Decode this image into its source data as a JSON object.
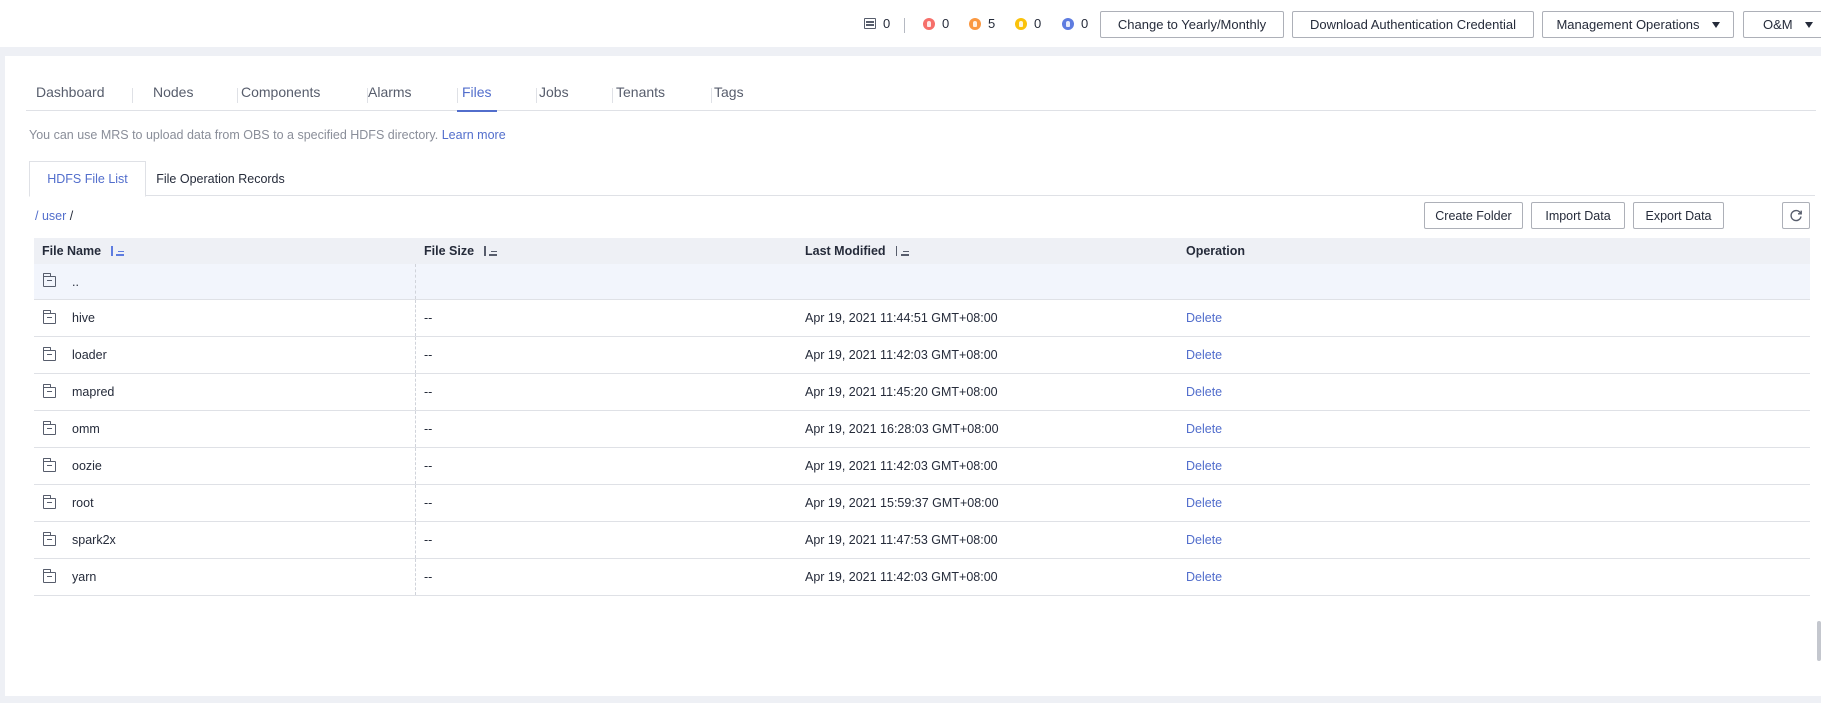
{
  "header": {
    "counters": [
      {
        "icon": "server-icon",
        "value": "0",
        "color": "#575d6c"
      },
      {
        "icon": "critical-alarm-icon",
        "value": "0",
        "color": "#f66f6a"
      },
      {
        "icon": "major-alarm-icon",
        "value": "5",
        "color": "#fa9841"
      },
      {
        "icon": "minor-alarm-icon",
        "value": "0",
        "color": "#fac20a"
      },
      {
        "icon": "warning-alarm-icon",
        "value": "0",
        "color": "#5e7ce0"
      }
    ],
    "buttons": {
      "change_billing": "Change to Yearly/Monthly",
      "download_credential": "Download Authentication Credential",
      "management_operations": "Management Operations",
      "om": "O&M"
    }
  },
  "tabs": [
    "Dashboard",
    "Nodes",
    "Components",
    "Alarms",
    "Files",
    "Jobs",
    "Tenants",
    "Tags"
  ],
  "active_tab": "Files",
  "tip": {
    "text": "You can use MRS to upload data from OBS to a specified HDFS directory.",
    "link": "Learn more"
  },
  "subtabs": [
    "HDFS File List",
    "File Operation Records"
  ],
  "breadcrumb": {
    "root": "/",
    "dir": "user",
    "trail": "/"
  },
  "actions": {
    "create_folder": "Create Folder",
    "import_data": "Import Data",
    "export_data": "Export Data"
  },
  "table": {
    "columns": [
      "File Name",
      "File Size",
      "Last Modified",
      "Operation"
    ],
    "parent_row": "..",
    "rows": [
      {
        "name": "hive",
        "size": "--",
        "modified": "Apr 19, 2021 11:44:51 GMT+08:00",
        "op": "Delete"
      },
      {
        "name": "loader",
        "size": "--",
        "modified": "Apr 19, 2021 11:42:03 GMT+08:00",
        "op": "Delete"
      },
      {
        "name": "mapred",
        "size": "--",
        "modified": "Apr 19, 2021 11:45:20 GMT+08:00",
        "op": "Delete"
      },
      {
        "name": "omm",
        "size": "--",
        "modified": "Apr 19, 2021 16:28:03 GMT+08:00",
        "op": "Delete"
      },
      {
        "name": "oozie",
        "size": "--",
        "modified": "Apr 19, 2021 11:42:03 GMT+08:00",
        "op": "Delete"
      },
      {
        "name": "root",
        "size": "--",
        "modified": "Apr 19, 2021 15:59:37 GMT+08:00",
        "op": "Delete"
      },
      {
        "name": "spark2x",
        "size": "--",
        "modified": "Apr 19, 2021 11:47:53 GMT+08:00",
        "op": "Delete"
      },
      {
        "name": "yarn",
        "size": "--",
        "modified": "Apr 19, 2021 11:42:03 GMT+08:00",
        "op": "Delete"
      }
    ]
  },
  "colors": {
    "accent": "#526ecc",
    "border": "#adb0b8",
    "page_bg": "#eef0f5"
  }
}
